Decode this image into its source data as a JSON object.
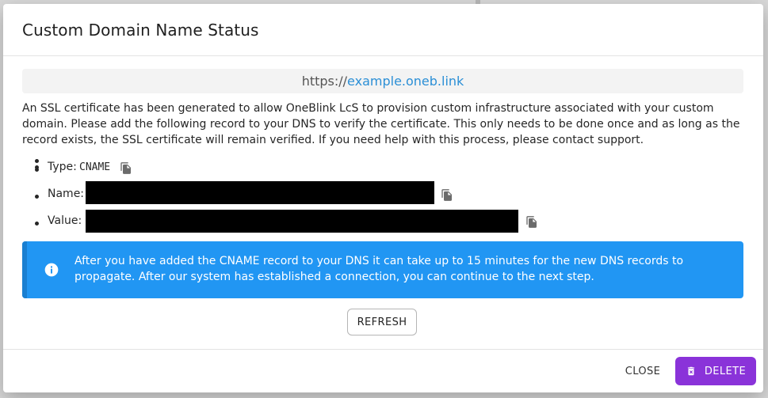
{
  "dialog": {
    "title": "Custom Domain Name Status",
    "url_prefix": "https://",
    "url_domain": "example.oneb.link",
    "description": "An SSL certificate has been generated to allow OneBlink LcS to provision custom infrastructure associated with your custom domain. Please add the following record to your DNS to verify the certificate. This only needs to be done once and as long as the record exists, the SSL certificate will remain verified. If you need help with this process, please contact support.",
    "records": {
      "type_label": "Type:",
      "type_value": "CNAME",
      "name_label": "Name:",
      "value_label": "Value:"
    },
    "alert": {
      "icon": "info-icon",
      "text": "After you have added the CNAME record to your DNS it can take up to 15 minutes for the new DNS records to propagate. After our system has established a connection, you can continue to the next step."
    },
    "refresh_label": "REFRESH",
    "close_label": "CLOSE",
    "delete_label": "DELETE",
    "colors": {
      "link": "#2b8fd6",
      "alert_bg": "#2196f3",
      "delete_bg": "#8a33d9"
    }
  }
}
